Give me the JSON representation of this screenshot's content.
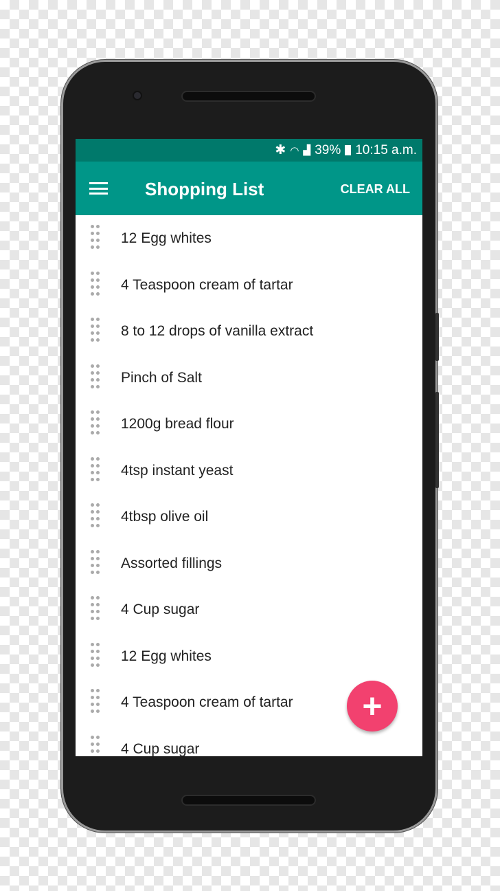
{
  "status": {
    "bluetooth_icon": "bluetooth-icon",
    "wifi_icon": "wifi-icon",
    "signal_icon": "signal-icon",
    "battery": "39%",
    "battery_icon": "battery-charging-icon",
    "time": "10:15 a.m."
  },
  "toolbar": {
    "menu_icon": "hamburger-menu-icon",
    "title": "Shopping List",
    "clear_all": "CLEAR ALL"
  },
  "items": [
    {
      "label": "12 Egg whites"
    },
    {
      "label": "4 Teaspoon cream of tartar"
    },
    {
      "label": "8 to 12 drops of vanilla extract"
    },
    {
      "label": "Pinch of Salt"
    },
    {
      "label": "1200g bread flour"
    },
    {
      "label": "4tsp instant yeast"
    },
    {
      "label": "4tbsp olive oil"
    },
    {
      "label": "Assorted fillings"
    },
    {
      "label": "4 Cup sugar"
    },
    {
      "label": "12 Egg whites"
    },
    {
      "label": "4 Teaspoon cream of tartar"
    },
    {
      "label": "4 Cup sugar"
    }
  ],
  "fab": {
    "icon": "plus-icon",
    "glyph": "+"
  },
  "colors": {
    "primary": "#009688",
    "primary_dark": "#00796b",
    "accent": "#f2416f"
  }
}
